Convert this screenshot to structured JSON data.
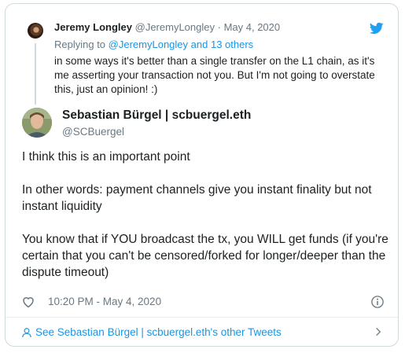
{
  "parent_tweet": {
    "author_name": "Jeremy Longley",
    "author_handle": "@JeremyLongley",
    "separator": "·",
    "date": "May 4, 2020",
    "replying_prefix": "Replying to",
    "replying_mention": "@JeremyLongley",
    "replying_suffix": "and 13 others",
    "body": "in some ways it's better than a single transfer on the L1 chain, as it's me asserting your transaction not you.  But I'm not going to overstate this, just an opinion! :)"
  },
  "main_tweet": {
    "author_name": "Sebastian Bürgel | scbuergel.eth",
    "author_handle": "@SCBuergel",
    "paragraphs": [
      "I think this is an important point",
      "In other words: payment channels give you instant finality but not instant liquidity",
      "You know that if YOU broadcast the tx, you WILL get funds (if you're certain that you can't be censored/forked for longer/deeper than the dispute timeout)"
    ],
    "timestamp": "10:20 PM - May 4, 2020"
  },
  "footer": {
    "link_text": "See Sebastian Bürgel | scbuergel.eth's other Tweets"
  },
  "icons": {
    "bird": "twitter-bird-icon",
    "heart": "heart-icon",
    "info": "info-icon",
    "person": "person-icon",
    "chevron": "chevron-right-icon"
  },
  "colors": {
    "accent": "#1b95e0",
    "secondary_text": "#697882",
    "border": "#cfd9de"
  }
}
